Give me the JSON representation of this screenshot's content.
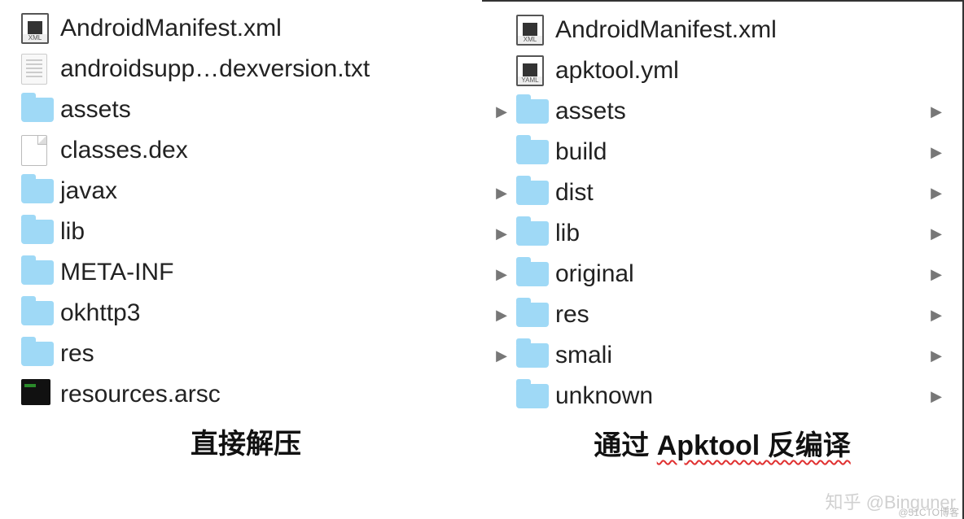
{
  "left": {
    "items": [
      {
        "name": "AndroidManifest.xml",
        "icon": "xml",
        "expand": false,
        "trail": false
      },
      {
        "name": "androidsupp…dexversion.txt",
        "icon": "txt",
        "expand": false,
        "trail": false
      },
      {
        "name": "assets",
        "icon": "folder",
        "expand": false,
        "trail": false
      },
      {
        "name": "classes.dex",
        "icon": "blank",
        "expand": false,
        "trail": false
      },
      {
        "name": "javax",
        "icon": "folder",
        "expand": false,
        "trail": false
      },
      {
        "name": "lib",
        "icon": "folder",
        "expand": false,
        "trail": false
      },
      {
        "name": "META-INF",
        "icon": "folder",
        "expand": false,
        "trail": false
      },
      {
        "name": "okhttp3",
        "icon": "folder",
        "expand": false,
        "trail": false
      },
      {
        "name": "res",
        "icon": "folder",
        "expand": false,
        "trail": false
      },
      {
        "name": "resources.arsc",
        "icon": "arsc",
        "expand": false,
        "trail": false
      }
    ],
    "caption": "直接解压"
  },
  "right": {
    "items": [
      {
        "name": "AndroidManifest.xml",
        "icon": "xml",
        "expand": false,
        "trail": false
      },
      {
        "name": "apktool.yml",
        "icon": "yaml",
        "expand": false,
        "trail": false
      },
      {
        "name": "assets",
        "icon": "folder",
        "expand": true,
        "trail": true
      },
      {
        "name": "build",
        "icon": "folder",
        "expand": false,
        "trail": true
      },
      {
        "name": "dist",
        "icon": "folder",
        "expand": true,
        "trail": true
      },
      {
        "name": "lib",
        "icon": "folder",
        "expand": true,
        "trail": true
      },
      {
        "name": "original",
        "icon": "folder",
        "expand": true,
        "trail": true
      },
      {
        "name": "res",
        "icon": "folder",
        "expand": true,
        "trail": true
      },
      {
        "name": "smali",
        "icon": "folder",
        "expand": true,
        "trail": true
      },
      {
        "name": "unknown",
        "icon": "folder",
        "expand": false,
        "trail": true
      }
    ],
    "caption_before": "通过 ",
    "caption_mid": "Apktool",
    "caption_after": " 反编译"
  },
  "watermark": "知乎 @Binguner",
  "attribution": "@51CTO博客",
  "glyphs": {
    "caret": "▶"
  },
  "icon_labels": {
    "xml": "XML",
    "yaml": "YAML"
  }
}
